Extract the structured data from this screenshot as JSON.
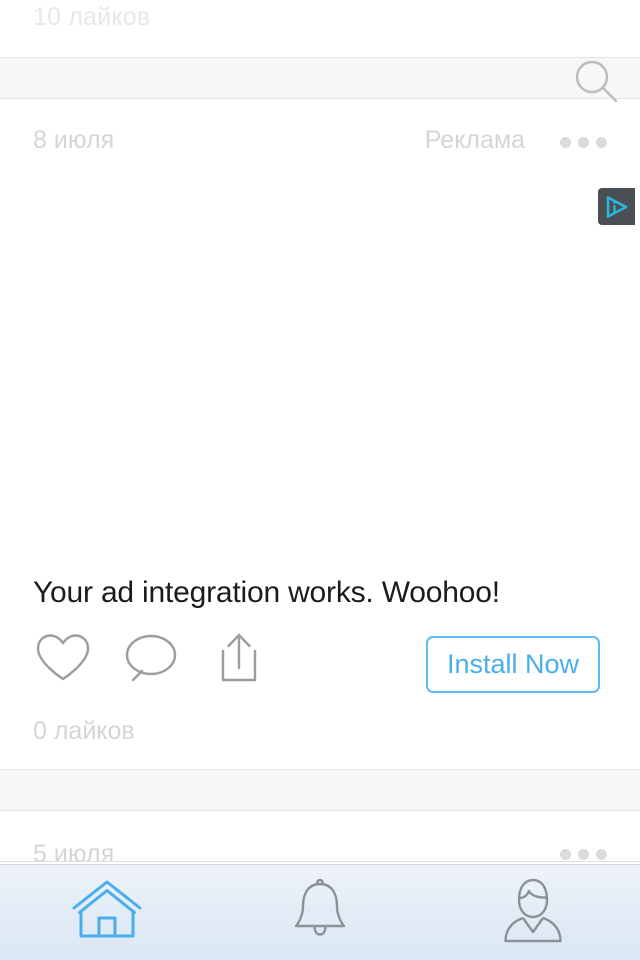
{
  "app": {
    "platform": "mobile-social-feed",
    "accent_color": "#4aaeea",
    "muted_text_color": "#d3d5d8",
    "adchoices_badge_color": "#4a4f54",
    "adchoices_glyph_color": "#29b6d8"
  },
  "top_post": {
    "likes_label": "10 лайков"
  },
  "search_bar": {
    "icon": "search-icon",
    "value": "",
    "placeholder": ""
  },
  "ad_post": {
    "date": "8 июля",
    "sponsored_label": "Реклама",
    "overflow_menu": "•••",
    "adchoices_badge": "AdChoices",
    "headline": "Your ad integration works. Woohoo!",
    "cta_label": "Install Now",
    "likes_label": "0 лайков",
    "actions": [
      {
        "name": "like-button",
        "icon": "heart-icon"
      },
      {
        "name": "comment-button",
        "icon": "speech-bubble-icon"
      },
      {
        "name": "share-button",
        "icon": "share-upload-icon"
      }
    ]
  },
  "next_post": {
    "date": "5 июля",
    "overflow_menu": "•••"
  },
  "tabbar": {
    "items": [
      {
        "name": "tab-home",
        "icon": "home-icon",
        "active": true
      },
      {
        "name": "tab-notifications",
        "icon": "bell-icon",
        "active": false
      },
      {
        "name": "tab-profile",
        "icon": "person-icon",
        "active": false
      }
    ]
  }
}
